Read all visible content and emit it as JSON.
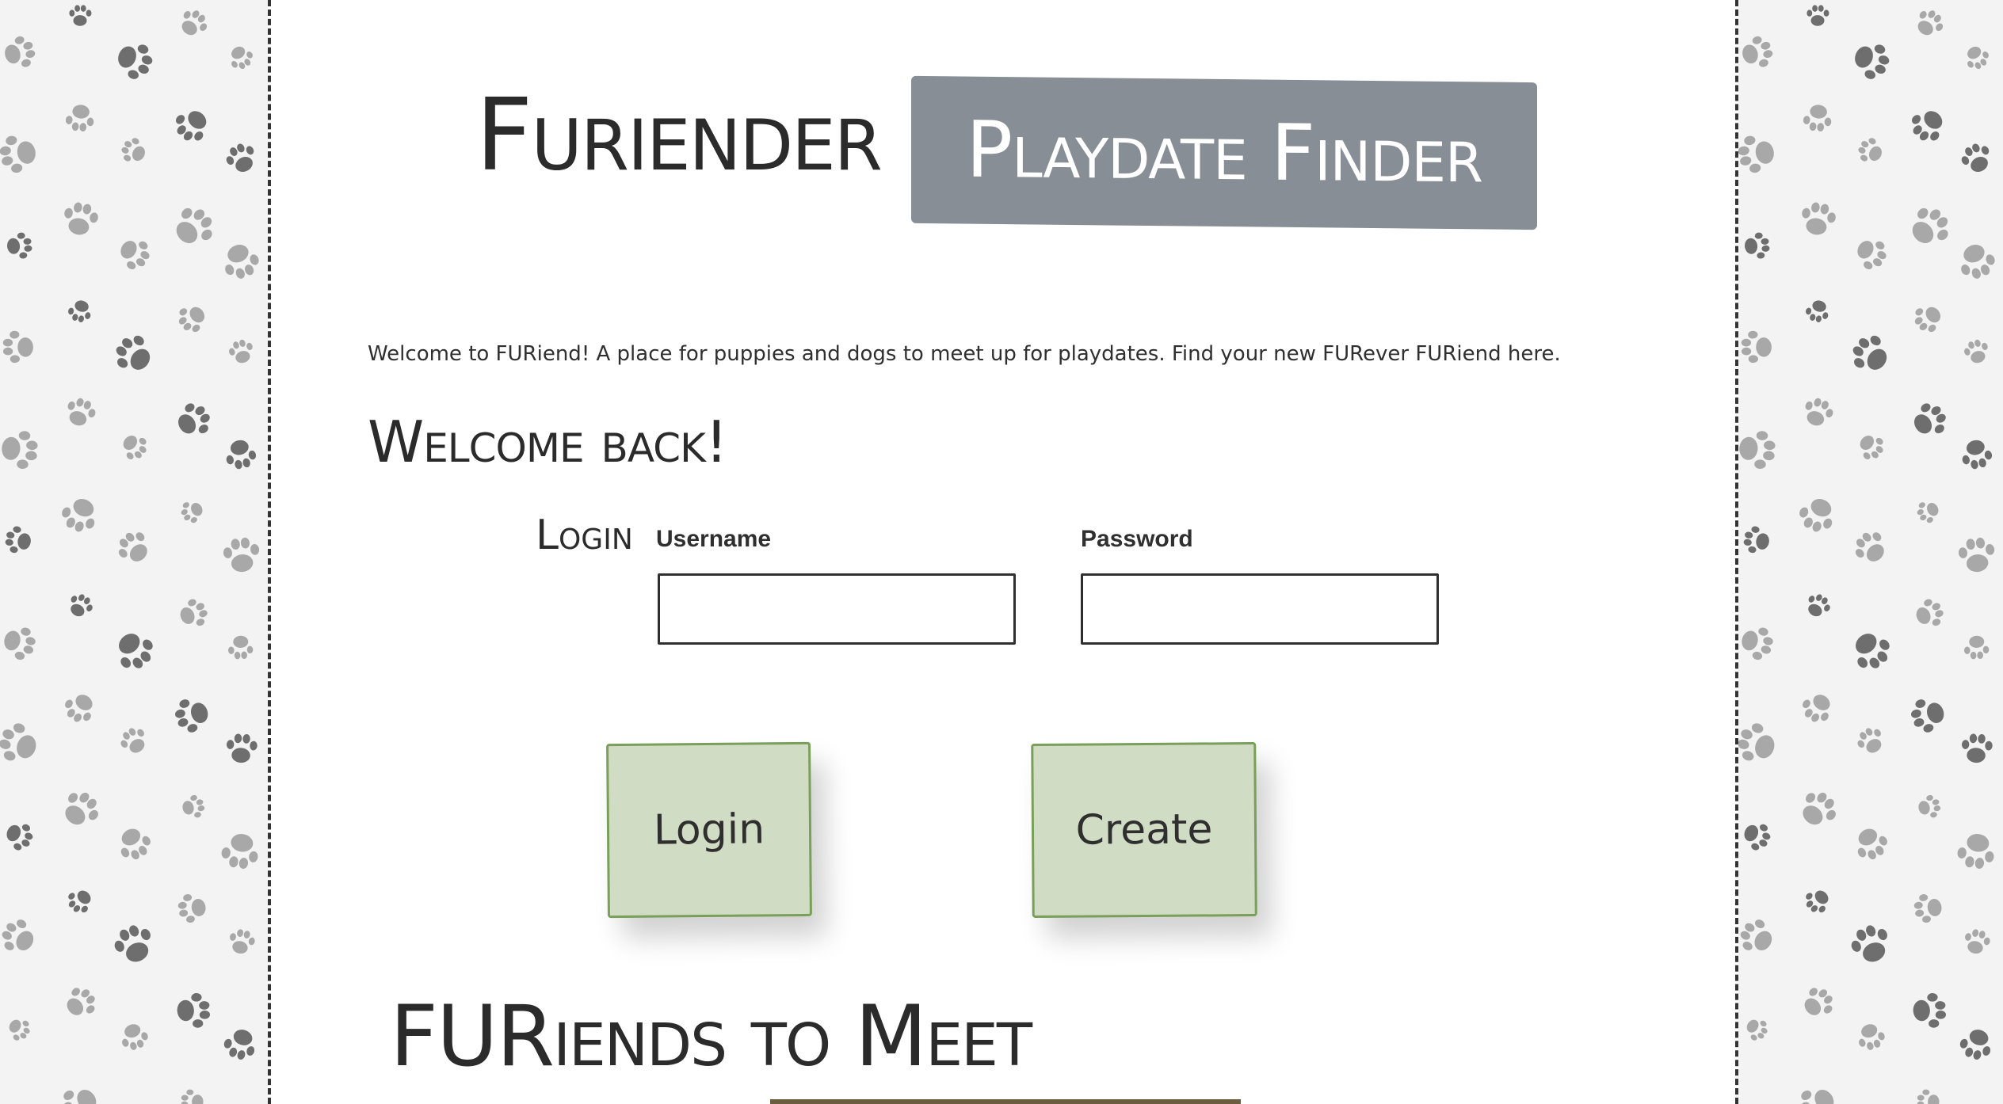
{
  "header": {
    "brand": "Furiender",
    "banner": "Playdate Finder"
  },
  "intro_text": "Welcome to FURiend! A place for puppies and dogs to meet up for playdates. Find your new FURever FURiend here.",
  "welcome_heading": "Welcome back!",
  "login_form": {
    "heading": "Login",
    "username_label": "Username",
    "username_value": "",
    "password_label": "Password",
    "password_value": "",
    "login_button": "Login",
    "create_button": "Create"
  },
  "friends_heading": "FURiends to Meet",
  "colors": {
    "banner": "#878e96",
    "button_fill": "#d1dcc4",
    "button_border": "#7a9f5a",
    "paw_dark": "#6e6e6e",
    "paw_light": "#a8a8a8"
  },
  "icons": {
    "side_pattern": "paw-print-icon"
  }
}
